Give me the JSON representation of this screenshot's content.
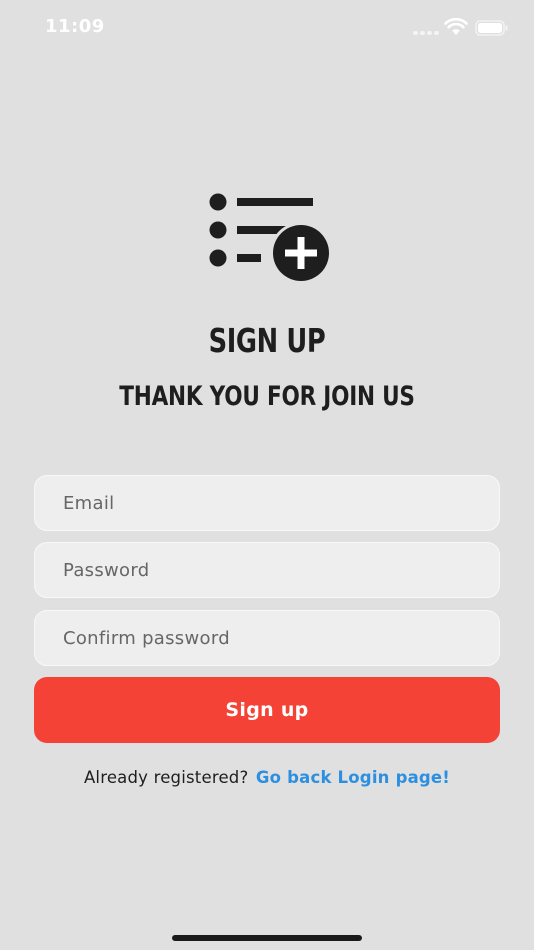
{
  "status_bar": {
    "time": "11:09",
    "icons": [
      "cellular-signal-icon",
      "wifi-icon",
      "battery-icon"
    ]
  },
  "logo": {
    "icon": "add-list-icon"
  },
  "header": {
    "title": "SIGN UP",
    "subtitle": "THANK YOU FOR JOIN US"
  },
  "form": {
    "email_placeholder": "Email",
    "password_placeholder": "Password",
    "confirm_password_placeholder": "Confirm password",
    "submit_label": "Sign up"
  },
  "footer": {
    "prompt": "Already registered?",
    "link_label": "Go back Login page!"
  },
  "colors": {
    "background": "#e0e0e0",
    "primary_button": "#f44336",
    "link": "#2d8fe0",
    "text": "#1e1e1e",
    "field_background": "#eeeeee"
  }
}
